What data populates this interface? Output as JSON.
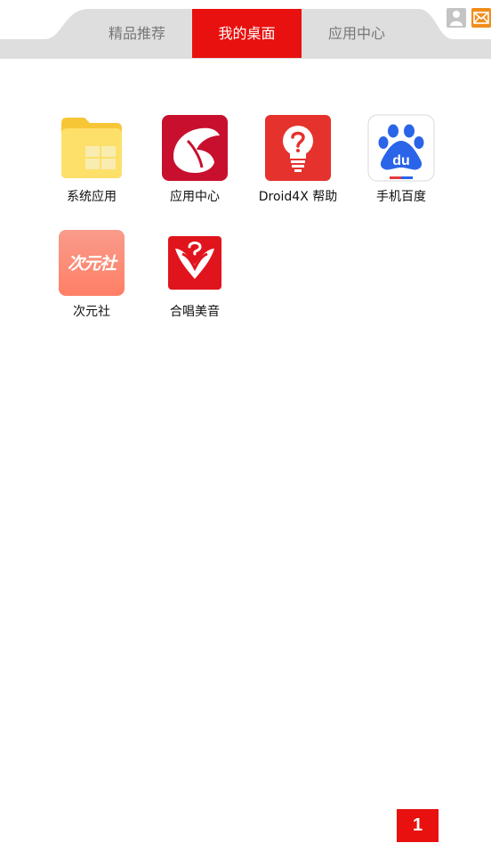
{
  "tabs": [
    {
      "label": "精品推荐",
      "active": false
    },
    {
      "label": "我的桌面",
      "active": true
    },
    {
      "label": "应用中心",
      "active": false
    }
  ],
  "corner_icons": {
    "user": "user-icon",
    "mail": "mail-icon"
  },
  "apps": [
    {
      "label": "系统应用",
      "icon": "folder-icon"
    },
    {
      "label": "应用中心",
      "icon": "app-center-icon"
    },
    {
      "label": "Droid4X 帮助",
      "icon": "help-bulb-icon"
    },
    {
      "label": "手机百度",
      "icon": "baidu-paw-icon"
    },
    {
      "label": "次元社",
      "icon": "ciyuanshe-icon",
      "icon_text": "次元社"
    },
    {
      "label": "合唱美音",
      "icon": "chorus-icon"
    }
  ],
  "page": {
    "current": "1"
  },
  "colors": {
    "accent": "#e8110f",
    "tabbar": "#dedede",
    "mail": "#f08d1c"
  }
}
